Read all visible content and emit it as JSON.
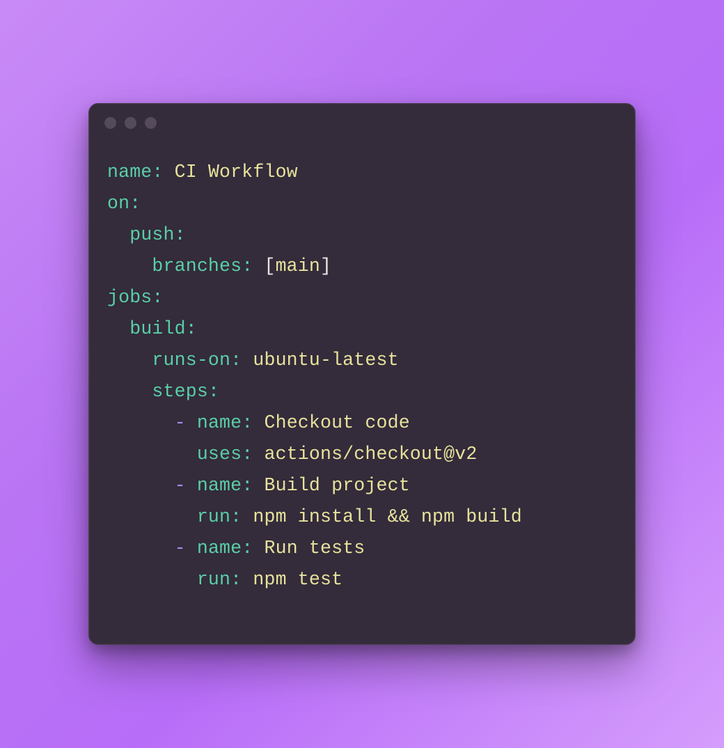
{
  "yaml": {
    "name_key": "name",
    "name_value": "CI Workflow",
    "on_key": "on",
    "push_key": "push",
    "branches_key": "branches",
    "branches_value": "main",
    "jobs_key": "jobs",
    "build_key": "build",
    "runs_on_key": "runs-on",
    "runs_on_value": "ubuntu-latest",
    "steps_key": "steps",
    "step1_name_key": "name",
    "step1_name_value": "Checkout code",
    "step1_uses_key": "uses",
    "step1_uses_value": "actions/checkout@v2",
    "step2_name_key": "name",
    "step2_name_value": "Build project",
    "step2_run_key": "run",
    "step2_run_value": "npm install && npm build",
    "step3_name_key": "name",
    "step3_name_value": "Run tests",
    "step3_run_key": "run",
    "step3_run_value": "npm test"
  },
  "punct": {
    "colon": ":",
    "lbracket": "[",
    "rbracket": "]",
    "dash": "-"
  }
}
